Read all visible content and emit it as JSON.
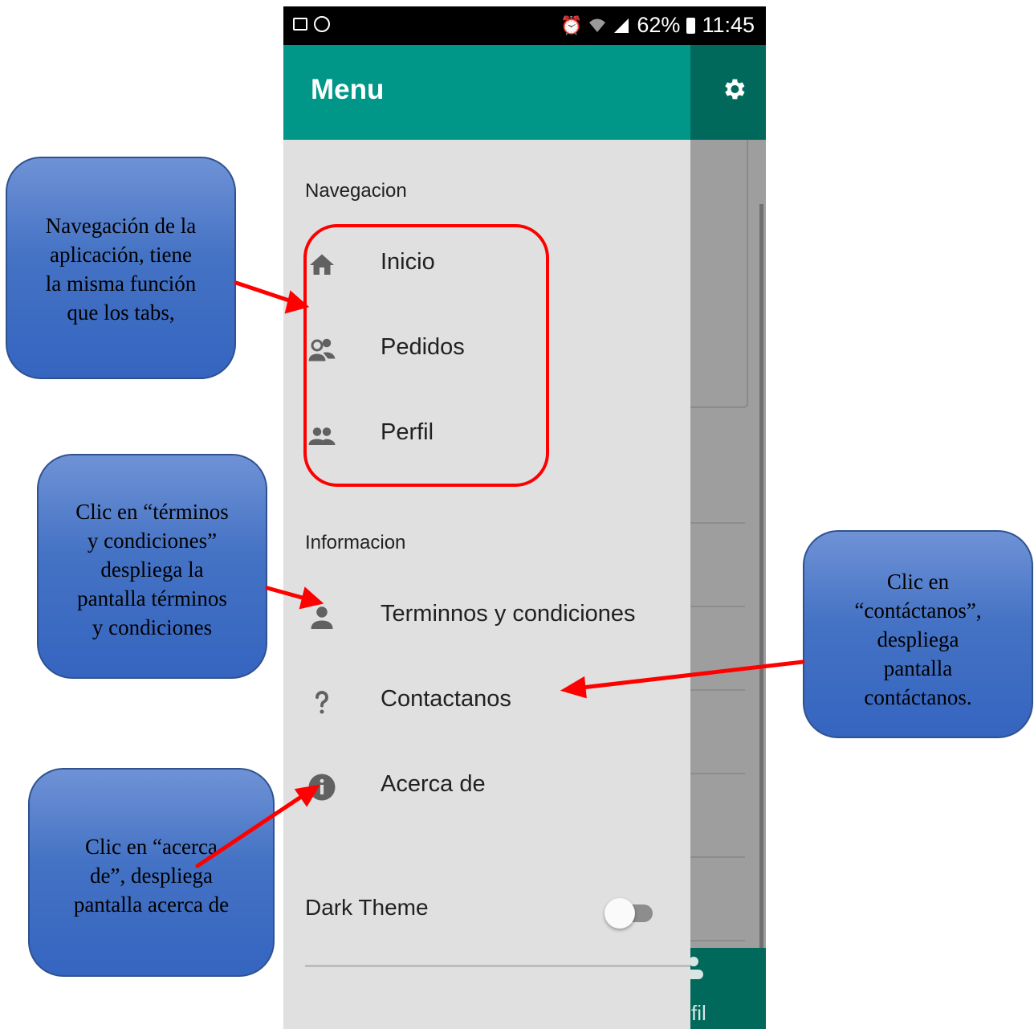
{
  "status_bar": {
    "battery_text": "62%",
    "time": "11:45",
    "left_icons": [
      "image-notification-icon",
      "whatsapp-icon"
    ],
    "right_icons": [
      "alarm-icon",
      "wifi-icon",
      "signal-icon",
      "battery-icon"
    ]
  },
  "drawer": {
    "title": "Menu",
    "sections": [
      {
        "label": "Navegacion",
        "items": [
          {
            "label": "Inicio",
            "icon": "home-icon"
          },
          {
            "label": "Pedidos",
            "icon": "people-outline-icon"
          },
          {
            "label": "Perfil",
            "icon": "people-icon"
          }
        ]
      },
      {
        "label": "Informacion",
        "items": [
          {
            "label": "Terminnos y condiciones",
            "icon": "person-icon"
          },
          {
            "label": "Contactanos",
            "icon": "help-icon"
          },
          {
            "label": "Acerca de",
            "icon": "info-icon"
          }
        ]
      }
    ],
    "dark_theme": {
      "label": "Dark Theme",
      "enabled": false
    }
  },
  "background_app": {
    "toolbar_icon": "settings-icon",
    "bottom_tab_partial": "fil",
    "bottom_tab_icon": "person-icon"
  },
  "annotations": {
    "nav": [
      "Navegación de la",
      "aplicación, tiene",
      "la misma función",
      "que los tabs,"
    ],
    "terms": [
      "Clic en “términos",
      "y condiciones”",
      "despliega la",
      "pantalla términos",
      "y condiciones"
    ],
    "contact": [
      "Clic en",
      "“contáctanos”,",
      "despliega",
      "pantalla",
      "contáctanos."
    ],
    "about": [
      "Clic en “acerca",
      "de”, despliega",
      "pantalla acerca de"
    ]
  },
  "colors": {
    "drawer_header": "#009688",
    "background_toolbar": "#00695c",
    "drawer_bg": "#e0e0e0",
    "callout": "#4472c4",
    "annotation_red": "#ff0000"
  }
}
